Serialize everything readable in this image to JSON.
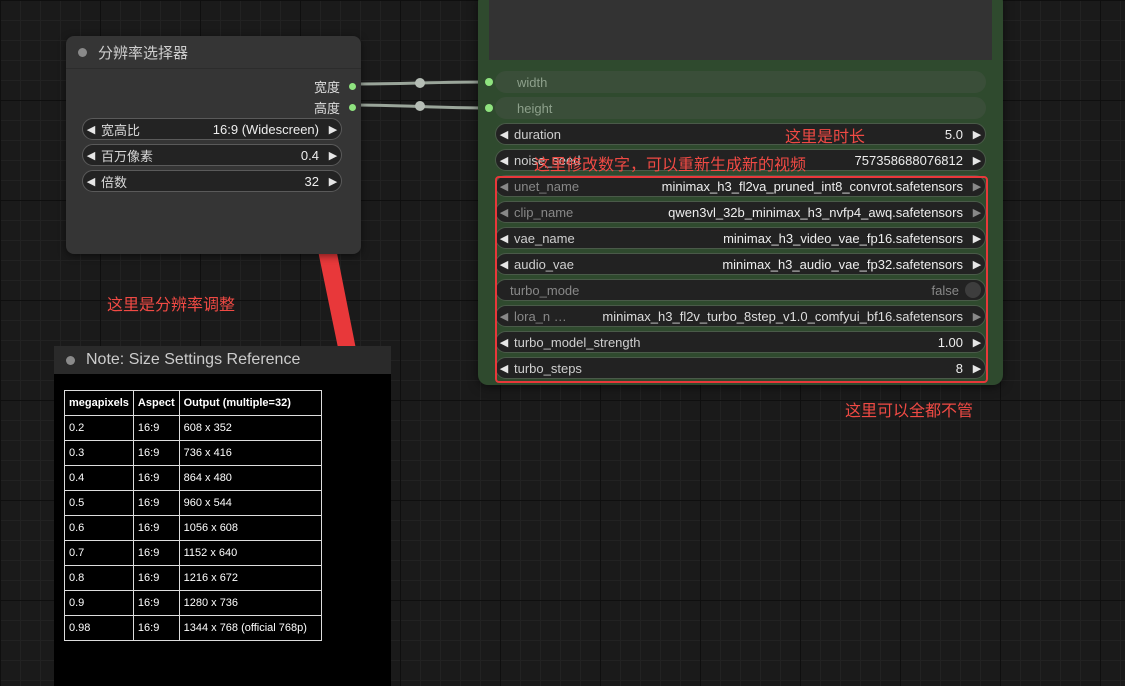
{
  "resolution_node": {
    "title": "分辨率选择器",
    "outputs": [
      "宽度",
      "高度"
    ],
    "widgets": [
      {
        "label": "宽高比",
        "value": "16:9 (Widescreen)"
      },
      {
        "label": "百万像素",
        "value": "0.4"
      },
      {
        "label": "倍数",
        "value": "32"
      }
    ]
  },
  "video_node": {
    "inputs": [
      "width",
      "height"
    ],
    "widgets": [
      {
        "label": "duration",
        "value": "5.0"
      },
      {
        "label": "noise_seed",
        "value": "757358688076812"
      },
      {
        "label": "unet_name",
        "value": "minimax_h3_fl2va_pruned_int8_convrot.safetensors"
      },
      {
        "label": "clip_name",
        "value": "qwen3vl_32b_minimax_h3_nvfp4_awq.safetensors"
      },
      {
        "label": "vae_name",
        "value": "minimax_h3_video_vae_fp16.safetensors"
      },
      {
        "label": "audio_vae",
        "value": "minimax_h3_audio_vae_fp32.safetensors"
      },
      {
        "label": "turbo_mode",
        "value": "false"
      },
      {
        "label": "lora_n …",
        "value": "minimax_h3_fl2v_turbo_8step_v1.0_comfyui_bf16.safetensors"
      },
      {
        "label": "turbo_model_strength",
        "value": "1.00"
      },
      {
        "label": "turbo_steps",
        "value": "8"
      }
    ]
  },
  "annotations": {
    "duration": "这里是时长",
    "seed": "这里修改数字，可以重新生成新的视频",
    "resolution": "这里是分辨率调整",
    "ignore": "这里可以全都不管"
  },
  "note_node": {
    "title": "Note: Size Settings Reference",
    "headers": [
      "megapixels",
      "Aspect",
      "Output (multiple=32)"
    ],
    "rows": [
      [
        "0.2",
        "16:9",
        "608 x 352"
      ],
      [
        "0.3",
        "16:9",
        "736 x 416"
      ],
      [
        "0.4",
        "16:9",
        "864 x 480"
      ],
      [
        "0.5",
        "16:9",
        "960 x 544"
      ],
      [
        "0.6",
        "16:9",
        "1056 x 608"
      ],
      [
        "0.7",
        "16:9",
        "1152 x 640"
      ],
      [
        "0.8",
        "16:9",
        "1216 x 672"
      ],
      [
        "0.9",
        "16:9",
        "1280 x 736"
      ],
      [
        "0.98",
        "16:9",
        "1344 x 768 (official 768p)"
      ]
    ]
  },
  "colors": {
    "accent_red": "#e8383a",
    "pin_green": "#8fe37f",
    "node_green": "#2f4a2e"
  }
}
